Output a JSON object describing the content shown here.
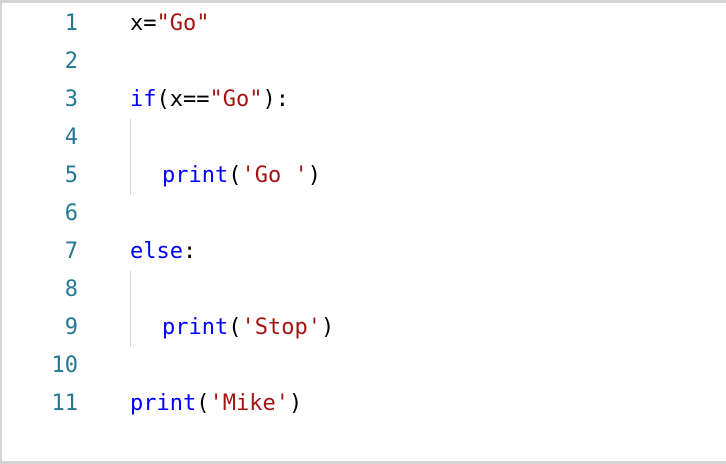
{
  "editor": {
    "line_numbers": [
      "1",
      "2",
      "3",
      "4",
      "5",
      "6",
      "7",
      "8",
      "9",
      "10",
      "11"
    ],
    "lines": {
      "l1": {
        "a": "x=",
        "b": "\"Go\""
      },
      "l3": {
        "a": "if",
        "b": "(x==",
        "c": "\"Go\"",
        "d": "):"
      },
      "l5": {
        "a": "print",
        "b": "(",
        "c": "'Go '",
        "d": ")"
      },
      "l7": {
        "a": "else",
        "b": ":"
      },
      "l9": {
        "a": "print",
        "b": "(",
        "c": "'Stop'",
        "d": ")"
      },
      "l11": {
        "a": "print",
        "b": "(",
        "c": "'Mike'",
        "d": ")"
      }
    },
    "colors": {
      "keyword": "#0000ff",
      "string": "#a31515",
      "line_number": "#237893",
      "text": "#000000"
    }
  }
}
